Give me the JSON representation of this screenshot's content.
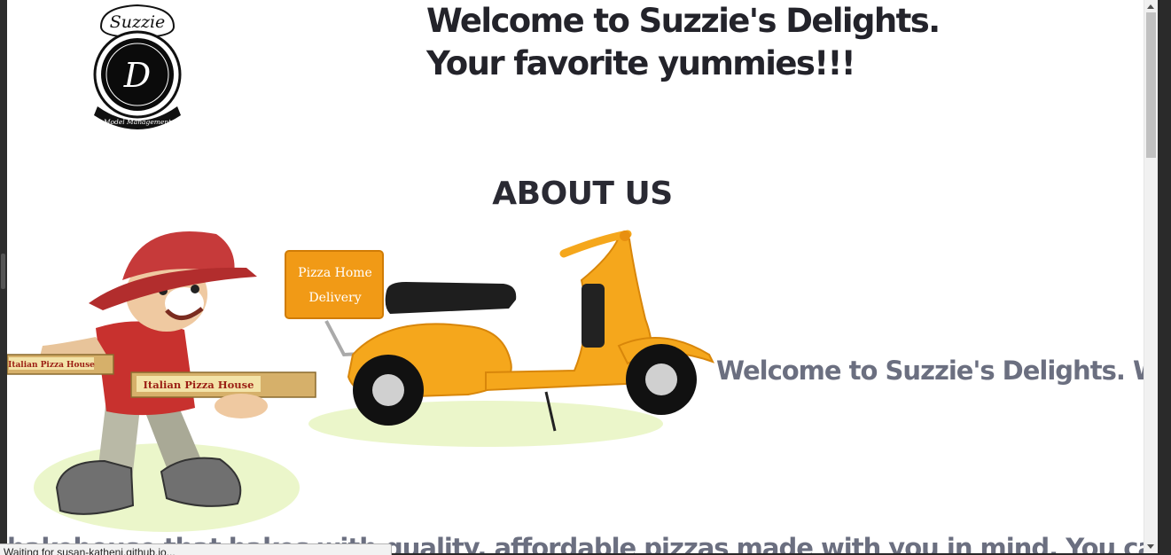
{
  "logo": {
    "script_text": "Suzzie",
    "monogram": "D",
    "ribbon_text": "Model Management"
  },
  "header": {
    "title_line1": "Welcome to Suzzie's Delights.",
    "title_line2": "Your favorite yummies!!!"
  },
  "about": {
    "heading": "ABOUT US",
    "text_line1": "Welcome to Suzzie's Delights. We are a",
    "text_line2": "bakehouse that bakes with quality, affordable pizzas made with you in mind. You can visit our"
  },
  "hero_image": {
    "box_label_line1": "Pizza Home",
    "box_label_line2": "Delivery",
    "pizza_box_label": "Italian Pizza House",
    "pizza_box_label_2": "Italian Pizza House"
  },
  "status_bar": {
    "text": "Waiting for susan-katheni.github.io..."
  },
  "colors": {
    "title": "#23232a",
    "body_text": "#6b6f80",
    "scooter": "#f5a71c",
    "cap": "#c63a3a"
  }
}
